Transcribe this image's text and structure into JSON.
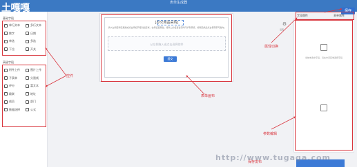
{
  "header": {
    "logo": "土嘎嘎",
    "app_title": "表单生成器",
    "save_label": "保存"
  },
  "sidebar": {
    "section1_title": "基础字段",
    "section2_title": "高级字段",
    "basic_widgets": [
      "单行文本",
      "多行文本",
      "数字",
      "日期",
      "单选",
      "多选",
      "下拉",
      "开关"
    ],
    "advanced_widgets": [
      "附件上传",
      "图片上传",
      "子表单",
      "分割线",
      "评分",
      "富文本",
      "级联",
      "地址",
      "成员",
      "部门",
      "数据选择",
      "公式"
    ]
  },
  "canvas": {
    "form_title": "[办公用品采购]",
    "form_desc": "请从左侧控件区拖拽或点击添加字段到此区域，右侧设置属性。组件上的设置会实时同步到预览，编辑完成后点击保存即可发布。",
    "placeholder": "从左侧拖入或点击选择控件",
    "submit_label": "提交"
  },
  "props": {
    "tab1": "字段属性",
    "tab2": "表单属性",
    "side_label": "设置",
    "empty_hint": "当前未选中字段，请在中间区域选择字段"
  },
  "annotations": {
    "widgets": "控件",
    "canvas": "表单画布",
    "props_tabs": "属性切换",
    "props_panel": "参数编辑"
  },
  "footer": {
    "watermark": "http://www.tugaga.com",
    "label": "保存发布"
  },
  "colors": {
    "brand": "#3b79c3",
    "annotation": "#d9363e",
    "button": "#3c7ad6"
  }
}
